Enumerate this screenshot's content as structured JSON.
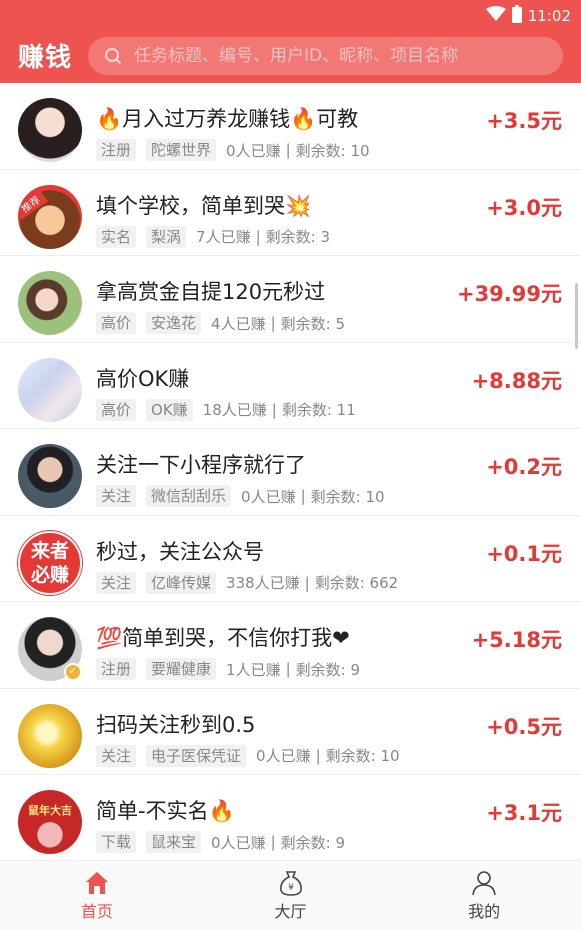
{
  "status_bar": {
    "time": "11:02",
    "icons": [
      "wifi-icon",
      "battery-icon"
    ]
  },
  "header": {
    "brand": "赚钱",
    "search_placeholder": "任务标题、编号、用户ID、昵称、项目名称"
  },
  "colors": {
    "accent": "#ef5350",
    "reward": "#e53935"
  },
  "tasks": [
    {
      "title": "🔥月入过万养龙赚钱🔥可教",
      "tags": [
        "注册",
        "陀螺世界"
      ],
      "earned": "0人已赚",
      "remaining": "剩余数: 10",
      "reward": "+3.5元",
      "avatar": "girl-portrait"
    },
    {
      "title": "填个学校，简单到哭💥",
      "tags": [
        "实名",
        "梨涡"
      ],
      "earned": "7人已赚",
      "remaining": "剩余数: 3",
      "reward": "+3.0元",
      "avatar": "cartoon-girl",
      "avatar_badge": "推荐"
    },
    {
      "title": "拿高赏金自提120元秒过",
      "tags": [
        "高价",
        "安逸花"
      ],
      "earned": "4人已赚",
      "remaining": "剩余数: 5",
      "reward": "+39.99元",
      "avatar": "outdoor-girl"
    },
    {
      "title": "高价OK赚",
      "tags": [
        "高价",
        "OK赚"
      ],
      "earned": "18人已赚",
      "remaining": "剩余数: 11",
      "reward": "+8.88元",
      "avatar": "anime-couple"
    },
    {
      "title": "关注一下小程序就行了",
      "tags": [
        "关注",
        "微信刮刮乐"
      ],
      "earned": "0人已赚",
      "remaining": "剩余数: 10",
      "reward": "+0.2元",
      "avatar": "boy-portrait"
    },
    {
      "title": "秒过，关注公众号",
      "tags": [
        "关注",
        "亿峰传媒"
      ],
      "earned": "338人已赚",
      "remaining": "剩余数: 662",
      "reward": "+0.1元",
      "avatar": "red-text-logo",
      "avatar_text": [
        "来者",
        "必赚"
      ]
    },
    {
      "title": "💯简单到哭，不信你打我❤",
      "tags": [
        "注册",
        "要耀健康"
      ],
      "earned": "1人已赚",
      "remaining": "剩余数: 9",
      "reward": "+5.18元",
      "avatar": "fitness-girl"
    },
    {
      "title": "扫码关注秒到0.5",
      "tags": [
        "关注",
        "电子医保凭证"
      ],
      "earned": "0人已赚",
      "remaining": "剩余数: 10",
      "reward": "+0.5元",
      "avatar": "sunset-silhouette"
    },
    {
      "title": "简单-不实名🔥",
      "tags": [
        "下载",
        "鼠来宝"
      ],
      "earned": "0人已赚",
      "remaining": "剩余数: 9",
      "reward": "+3.1元",
      "avatar": "rat-new-year",
      "avatar_text": [
        "鼠年大吉"
      ]
    }
  ],
  "tabbar": [
    {
      "label": "首页",
      "icon": "home-icon",
      "active": true
    },
    {
      "label": "大厅",
      "icon": "money-bag-icon",
      "active": false
    },
    {
      "label": "我的",
      "icon": "user-icon",
      "active": false
    }
  ]
}
